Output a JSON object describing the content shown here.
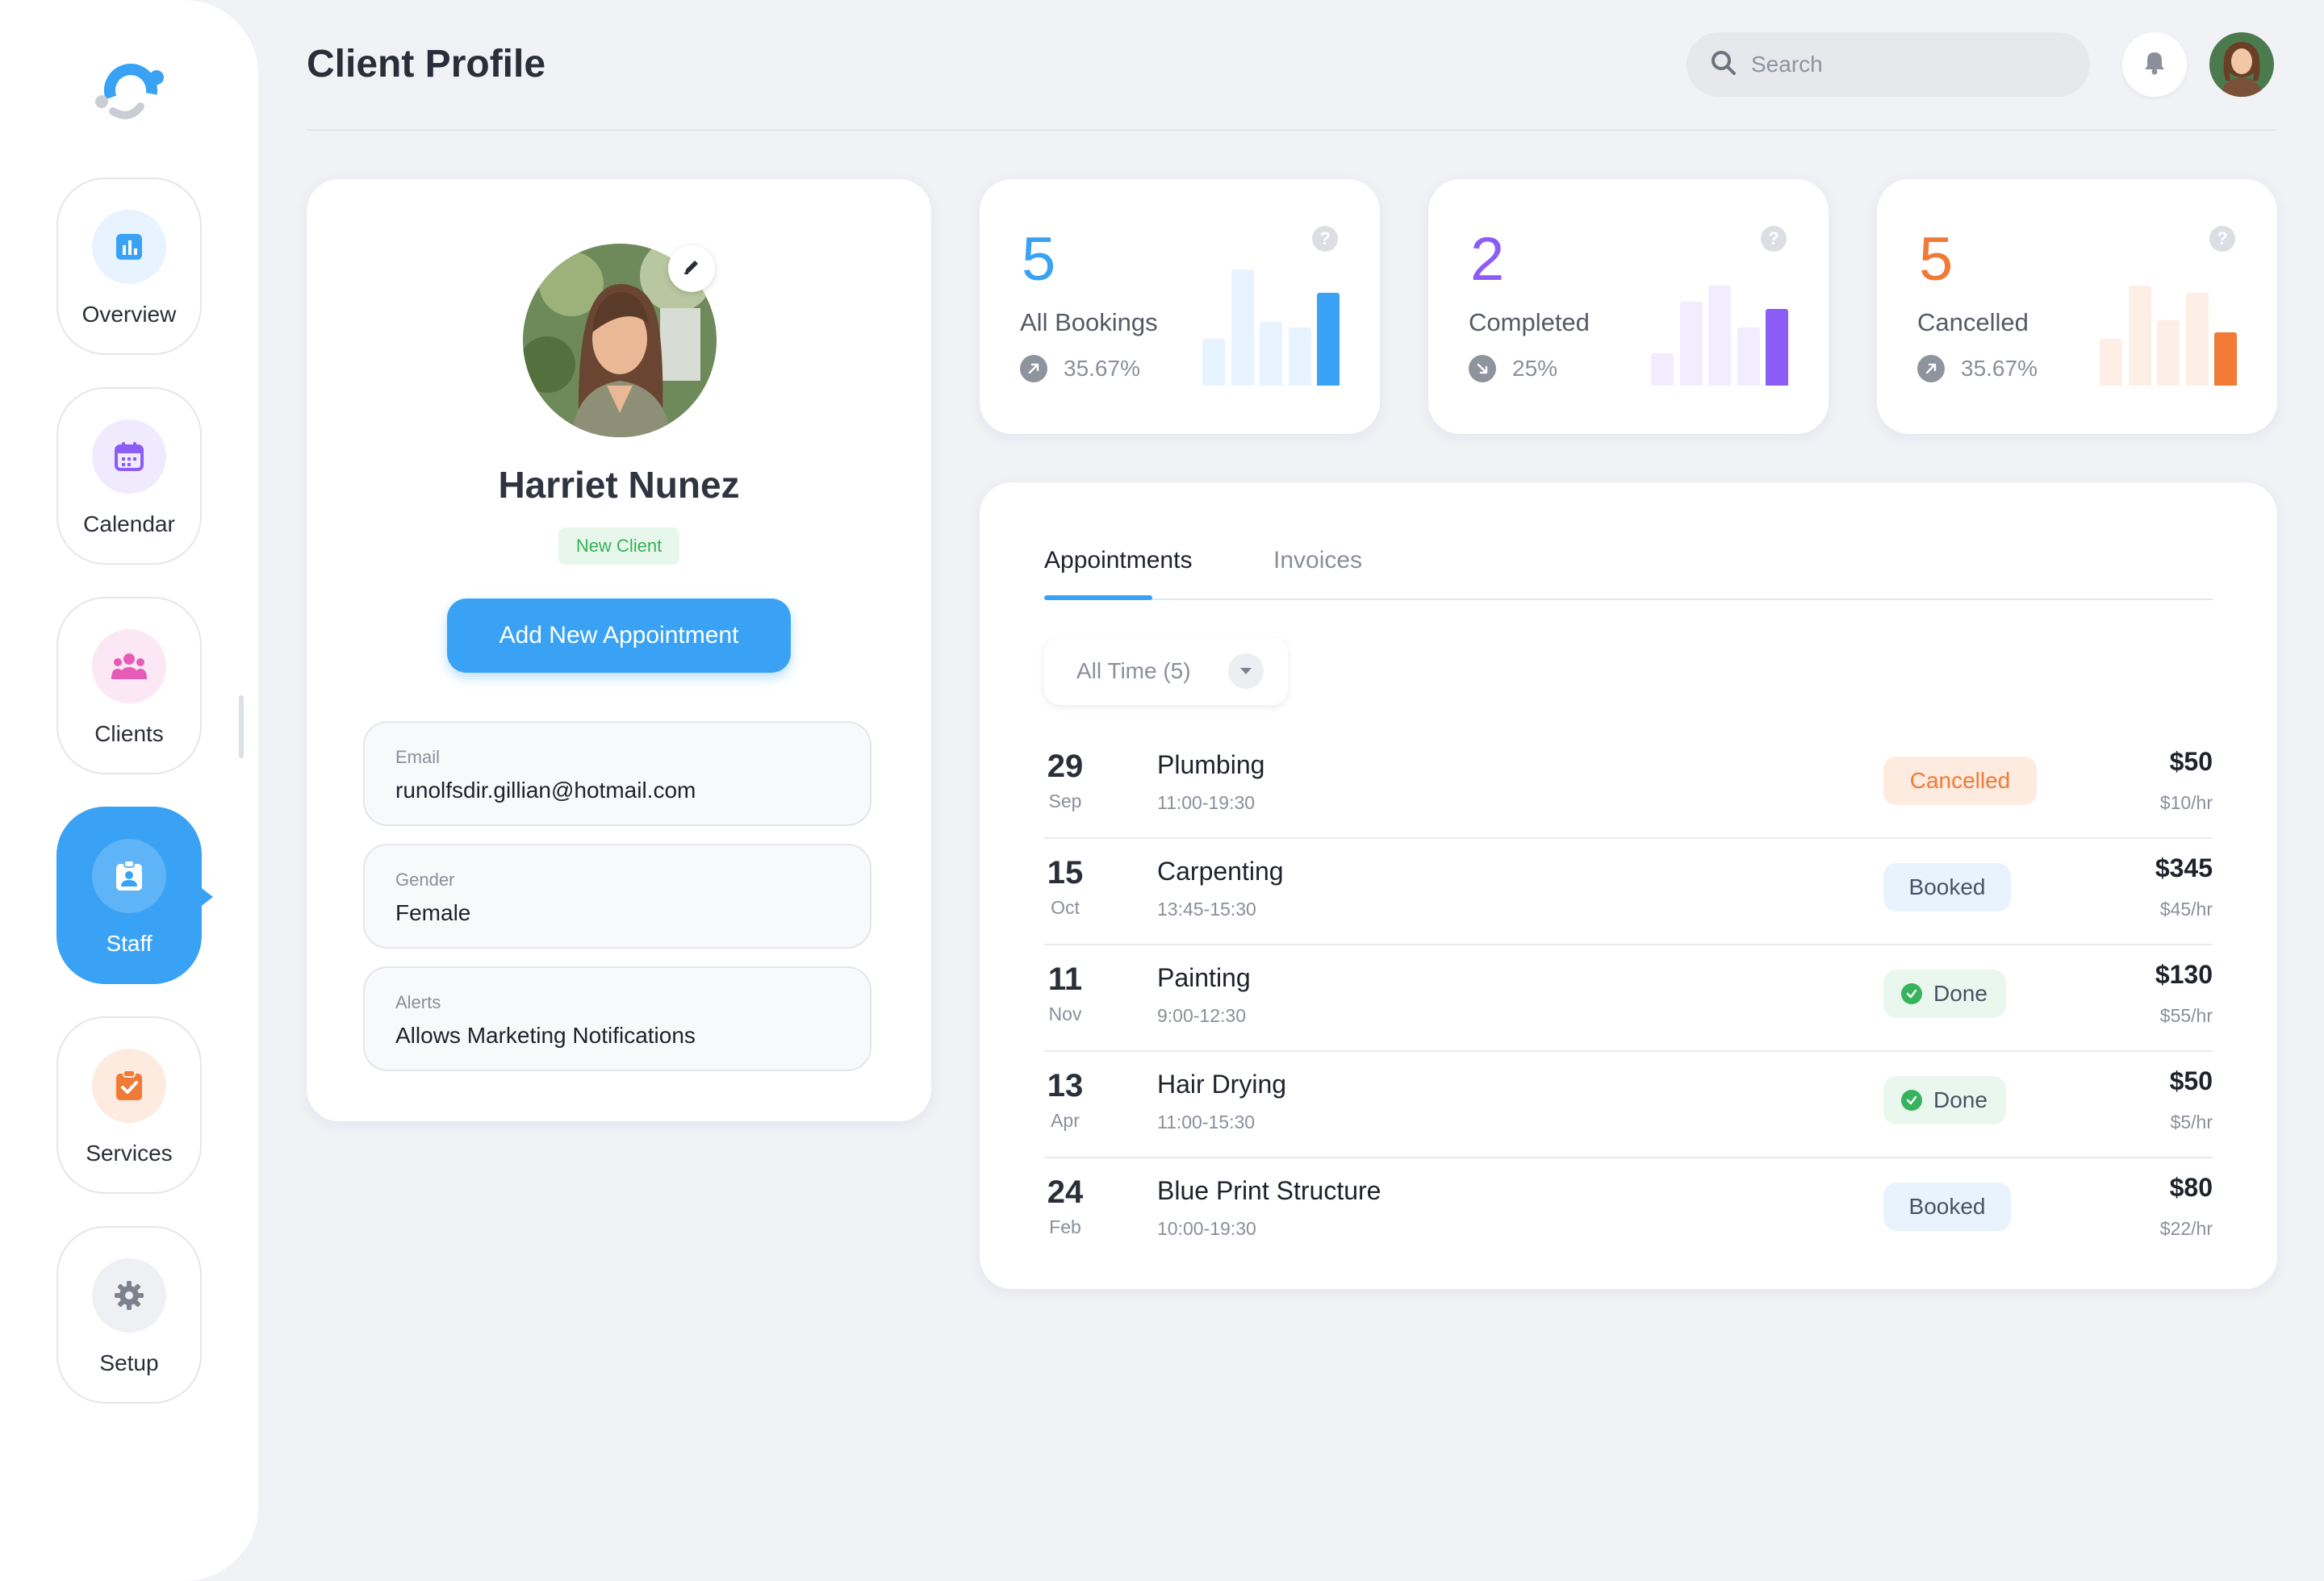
{
  "header": {
    "title": "Client Profile",
    "search_placeholder": "Search"
  },
  "sidebar": {
    "items": [
      {
        "label": "Overview",
        "icon": "chart-icon",
        "color": "#3AA2F5",
        "bg": "#E7F3FE"
      },
      {
        "label": "Calendar",
        "icon": "calendar-icon",
        "color": "#8B5CF6",
        "bg": "#F0EAFE"
      },
      {
        "label": "Clients",
        "icon": "clients-icon",
        "color": "#E65BB5",
        "bg": "#FCE8F4"
      },
      {
        "label": "Staff",
        "icon": "staff-icon",
        "color": "#3AA2F5",
        "bg": "#5FB4F7",
        "active": true
      },
      {
        "label": "Services",
        "icon": "clipboard-check-icon",
        "color": "#F07A36",
        "bg": "#FDEBE0"
      },
      {
        "label": "Setup",
        "icon": "gear-icon",
        "color": "#8A8F99",
        "bg": "#EEF0F3"
      }
    ]
  },
  "profile": {
    "name": "Harriet Nunez",
    "badge": "New Client",
    "add_button": "Add New Appointment",
    "fields": [
      {
        "label": "Email",
        "value": "runolfsdir.gillian@hotmail.com"
      },
      {
        "label": "Gender",
        "value": "Female"
      },
      {
        "label": "Alerts",
        "value": "Allows Marketing Notifications"
      }
    ]
  },
  "stats": [
    {
      "value": "5",
      "label": "All Bookings",
      "trend": "35.67%",
      "trend_dir": "up",
      "color": "#3AA2F5",
      "light": "#E7F3FE",
      "bars": [
        0.4,
        1.0,
        0.55,
        0.5,
        0.8
      ]
    },
    {
      "value": "2",
      "label": "Completed",
      "trend": "25%",
      "trend_dir": "down",
      "color": "#8B5CF6",
      "light": "#F1ECFE",
      "bars": [
        0.28,
        0.72,
        0.86,
        0.5,
        0.66
      ]
    },
    {
      "value": "5",
      "label": "Cancelled",
      "trend": "35.67%",
      "trend_dir": "up",
      "color": "#F07A36",
      "light": "#FDEEE6",
      "bars": [
        0.4,
        0.86,
        0.56,
        0.8,
        0.46
      ]
    }
  ],
  "appointments": {
    "tabs": [
      "Appointments",
      "Invoices"
    ],
    "filter": "All Time (5)",
    "rows": [
      {
        "day": "29",
        "month": "Sep",
        "service": "Plumbing",
        "time": "11:00-19:30",
        "status": "Cancelled",
        "status_type": "cancelled",
        "price": "$50",
        "rate": "$10/hr"
      },
      {
        "day": "15",
        "month": "Oct",
        "service": "Carpenting",
        "time": "13:45-15:30",
        "status": "Booked",
        "status_type": "booked",
        "price": "$345",
        "rate": "$45/hr"
      },
      {
        "day": "11",
        "month": "Nov",
        "service": "Painting",
        "time": "9:00-12:30",
        "status": "Done",
        "status_type": "done",
        "price": "$130",
        "rate": "$55/hr"
      },
      {
        "day": "13",
        "month": "Apr",
        "service": "Hair Drying",
        "time": "11:00-15:30",
        "status": "Done",
        "status_type": "done",
        "price": "$50",
        "rate": "$5/hr"
      },
      {
        "day": "24",
        "month": "Feb",
        "service": "Blue Print Structure",
        "time": "10:00-19:30",
        "status": "Booked",
        "status_type": "booked",
        "price": "$80",
        "rate": "$22/hr"
      }
    ]
  }
}
